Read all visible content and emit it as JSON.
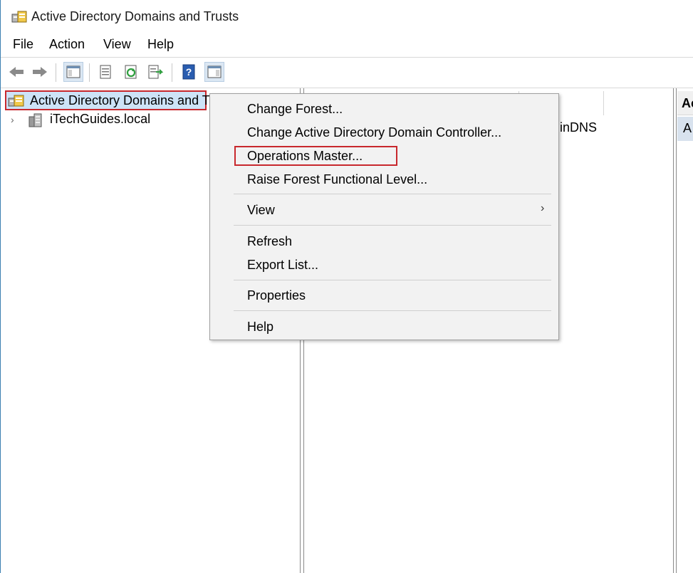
{
  "window": {
    "title": "Active Directory Domains and Trusts"
  },
  "menubar": {
    "items": [
      "File",
      "Action",
      "View",
      "Help"
    ]
  },
  "toolbar": {
    "buttons": [
      "back-icon",
      "forward-icon",
      "show-hide-tree-icon",
      "properties-icon",
      "refresh-icon",
      "export-list-icon",
      "help-icon",
      "show-hide-action-pane-icon"
    ]
  },
  "tree": {
    "root_label": "Active Directory Domains and Trusts",
    "child_label": "iTechGuides.local"
  },
  "middle": {
    "visible_cell": "inDNS"
  },
  "right": {
    "header": "Ac",
    "row": "A"
  },
  "context_menu": {
    "items": [
      "Change Forest...",
      "Change Active Directory Domain Controller...",
      "Operations Master...",
      "Raise Forest Functional Level...",
      "View",
      "Refresh",
      "Export List...",
      "Properties",
      "Help"
    ],
    "submenu_arrow": "›",
    "highlighted": "Operations Master..."
  },
  "colors": {
    "highlight_box": "#c8282d",
    "selection": "#cde3f7",
    "menu_bg": "#f2f2f2"
  }
}
